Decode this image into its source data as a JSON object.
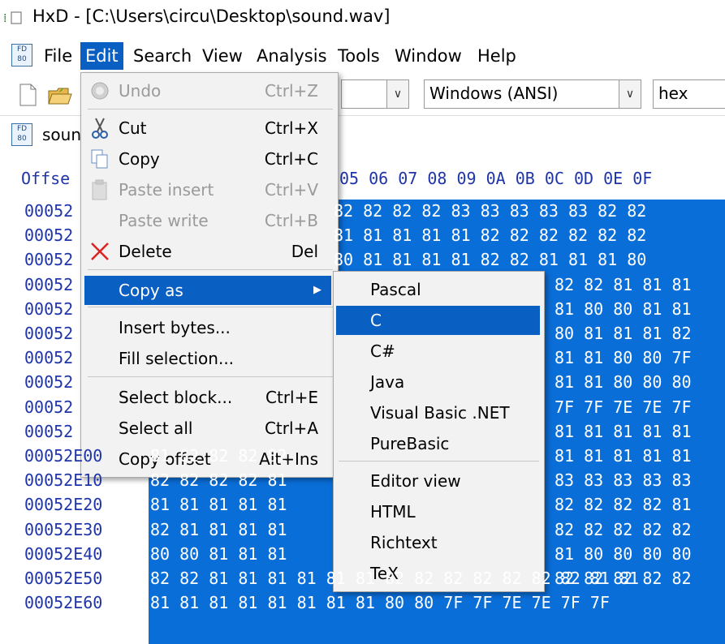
{
  "window": {
    "title": "HxD - [C:\\Users\\circu\\Desktop\\sound.wav]",
    "app_icon": "hxd-app-icon"
  },
  "menubar": {
    "items": [
      {
        "label": "File"
      },
      {
        "label": "Edit"
      },
      {
        "label": "Search"
      },
      {
        "label": "View"
      },
      {
        "label": "Analysis"
      },
      {
        "label": "Tools"
      },
      {
        "label": "Window"
      },
      {
        "label": "Help"
      }
    ],
    "active": "Edit"
  },
  "toolbar": {
    "encoding": "Windows (ANSI)",
    "number_format": "hex"
  },
  "tab": {
    "label": "soun"
  },
  "hex": {
    "header_prefix": "Offse",
    "header_cols": "05 06 07 08 09 0A 0B 0C 0D 0E 0F",
    "offsets_hidden": [
      "00052",
      "00052",
      "00052",
      "00052",
      "00052",
      "00052",
      "00052",
      "00052",
      "00052",
      "00052"
    ],
    "offsets": [
      "00052E00",
      "00052E10",
      "00052E20",
      "00052E30",
      "00052E40",
      "00052E50",
      "00052E60"
    ],
    "right_rows": [
      "82 82 82 82 83 83 83 83 83 82 82",
      "81 81 81 81 81 82 82 82 82 82 82",
      "80 81 81 81 81 82 82 81 81 81 80",
      "82 82 81 81 81",
      "81 80 80 81 81",
      "80 81 81 81 82",
      "81 81 80 80 7F",
      "81 81 80 80 80",
      "7F 7F 7E 7E 7F",
      "81 81 81 81 81",
      "81 81 81 81 81",
      "83 83 83 83 83",
      "82 82 82 82 81",
      "82 82 82 82 82",
      "81 80 80 80 80",
      "82 82 82 82 82"
    ],
    "bottom_rows": [
      "81 82 82 82 82",
      "82 82 82 82 81",
      "81 81 81 81 81",
      "82 81 81 81 81",
      "80 80 81 81 81",
      "82 82 81 81 81 81 81 81 82 82 82 82 82 82 82 81 81",
      "81 81 81 81 81 81 81 81 80 80 7F 7F 7E 7E 7F 7F"
    ]
  },
  "edit_menu": {
    "items": [
      {
        "label": "Undo",
        "shortcut": "Ctrl+Z",
        "enabled": false,
        "icon": "undo-icon"
      },
      {
        "label": "Cut",
        "shortcut": "Ctrl+X",
        "enabled": true,
        "icon": "scissors-icon"
      },
      {
        "label": "Copy",
        "shortcut": "Ctrl+C",
        "enabled": true,
        "icon": "copy-icon"
      },
      {
        "label": "Paste insert",
        "shortcut": "Ctrl+V",
        "enabled": false,
        "icon": "paste-icon"
      },
      {
        "label": "Paste write",
        "shortcut": "Ctrl+B",
        "enabled": false,
        "icon": ""
      },
      {
        "label": "Delete",
        "shortcut": "Del",
        "enabled": true,
        "icon": "delete-x-icon"
      },
      {
        "label": "Copy as",
        "shortcut": "",
        "enabled": true,
        "submenu": true
      },
      {
        "label": "Insert bytes...",
        "shortcut": "",
        "enabled": true
      },
      {
        "label": "Fill selection...",
        "shortcut": "",
        "enabled": true
      },
      {
        "label": "Select block...",
        "shortcut": "Ctrl+E",
        "enabled": true
      },
      {
        "label": "Select all",
        "shortcut": "Ctrl+A",
        "enabled": true
      },
      {
        "label": "Copy offset",
        "shortcut": "Alt+Ins",
        "enabled": true
      }
    ],
    "highlighted": "Copy as"
  },
  "copy_as_submenu": {
    "items": [
      "Pascal",
      "C",
      "C#",
      "Java",
      "Visual Basic .NET",
      "PureBasic",
      "Editor view",
      "HTML",
      "Richtext",
      "TeX"
    ],
    "highlighted": "C"
  },
  "colors": {
    "accent": "#0a5fc2",
    "selection": "#0a6ed8",
    "offset_text": "#1f35a8"
  }
}
